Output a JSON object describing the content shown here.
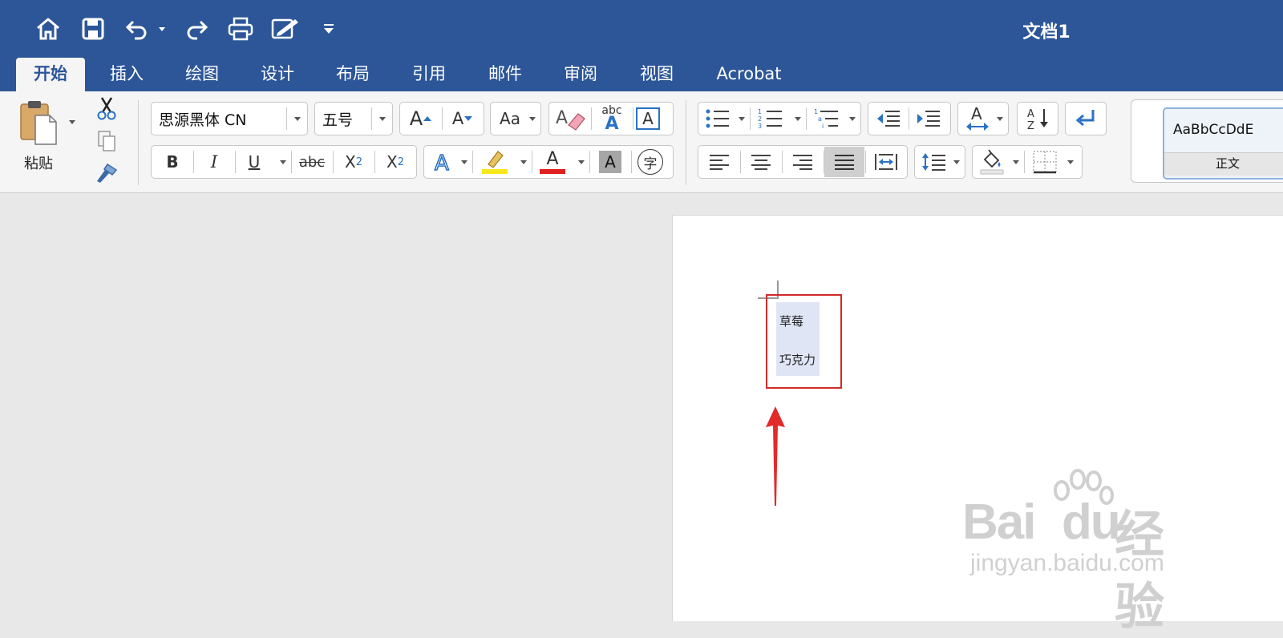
{
  "window": {
    "title": "文档1"
  },
  "tabs": [
    {
      "label": "开始",
      "active": true
    },
    {
      "label": "插入"
    },
    {
      "label": "绘图"
    },
    {
      "label": "设计"
    },
    {
      "label": "布局"
    },
    {
      "label": "引用"
    },
    {
      "label": "邮件"
    },
    {
      "label": "审阅"
    },
    {
      "label": "视图"
    },
    {
      "label": "Acrobat"
    }
  ],
  "clipboard": {
    "paste_label": "粘贴"
  },
  "font": {
    "name": "思源黑体 CN",
    "size": "五号",
    "bold_label": "B",
    "italic_label": "I",
    "underline_label": "U",
    "strike_label": "abc",
    "subscript_label": "X",
    "superscript_label": "X",
    "sub_index": "2",
    "sup_index": "2",
    "grow_label": "A",
    "shrink_label": "A",
    "change_case_label": "Aa",
    "phonetic_label": "abc",
    "border_char_label": "A",
    "enclose_char_label": "字",
    "shading_label": "A",
    "font_color_label": "A"
  },
  "colors": {
    "title_bar": "#2c5698",
    "highlight": "#f8e71c",
    "font_color": "#e02020",
    "selection": "#dfe5f5",
    "annotation": "#d22a2a"
  },
  "styles": {
    "sample": "AaBbCcDdE",
    "name": "正文"
  },
  "document": {
    "lines": [
      "草莓",
      "巧克力"
    ]
  },
  "watermark": {
    "brand": "Bai",
    "brand_end": "du",
    "suffix": "经验",
    "url": "jingyan.baidu.com"
  }
}
